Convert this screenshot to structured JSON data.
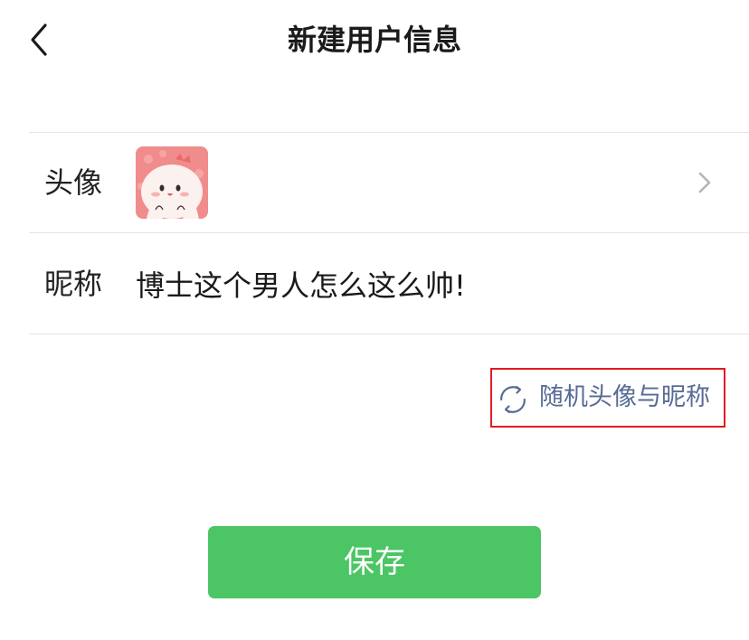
{
  "header": {
    "title": "新建用户信息",
    "back_icon": "chevron-left-icon"
  },
  "form": {
    "avatar_label": "头像",
    "avatar_icon": "chevron-right-icon",
    "nickname_label": "昵称",
    "nickname_value": "博士这个男人怎么这么帅!"
  },
  "random": {
    "label": "随机头像与昵称",
    "icon": "refresh-icon"
  },
  "actions": {
    "save_label": "保存"
  },
  "colors": {
    "primary_button": "#4cc565",
    "link_text": "#576b95",
    "highlight_border": "#e21b23"
  }
}
